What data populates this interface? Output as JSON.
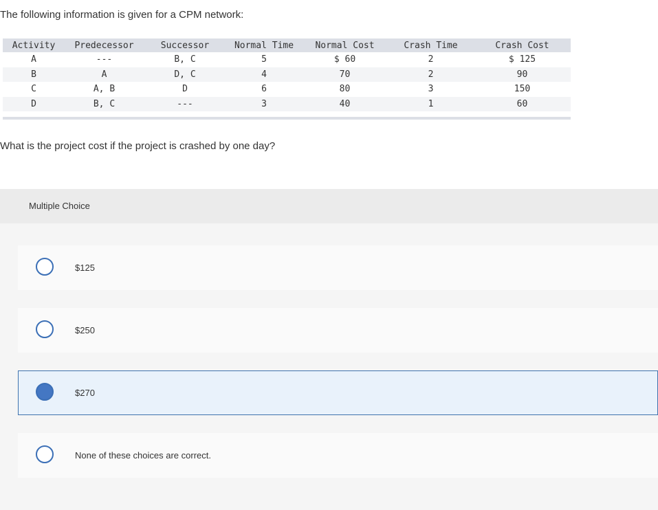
{
  "intro_text": "The following information is given for a CPM network:",
  "table": {
    "headers": {
      "activity": "Activity",
      "predecessor": "Predecessor",
      "successor": "Successor",
      "normal_time": "Normal Time",
      "normal_cost": "Normal Cost",
      "crash_time": "Crash Time",
      "crash_cost": "Crash Cost"
    },
    "rows": [
      {
        "activity": "A",
        "predecessor": "---",
        "successor": "B, C",
        "normal_time": "5",
        "normal_cost": "$ 60",
        "crash_time": "2",
        "crash_cost": "$ 125"
      },
      {
        "activity": "B",
        "predecessor": "A",
        "successor": "D, C",
        "normal_time": "4",
        "normal_cost": "70",
        "crash_time": "2",
        "crash_cost": "90"
      },
      {
        "activity": "C",
        "predecessor": "A, B",
        "successor": "D",
        "normal_time": "6",
        "normal_cost": "80",
        "crash_time": "3",
        "crash_cost": "150"
      },
      {
        "activity": "D",
        "predecessor": "B, C",
        "successor": "---",
        "normal_time": "3",
        "normal_cost": "40",
        "crash_time": "1",
        "crash_cost": "60"
      }
    ]
  },
  "question_text": "What is the project cost if the project is crashed by one day?",
  "multiple_choice": {
    "label": "Multiple Choice",
    "choices": [
      {
        "label": "$125",
        "selected": false
      },
      {
        "label": "$250",
        "selected": false
      },
      {
        "label": "$270",
        "selected": true
      },
      {
        "label": "None of these choices are correct.",
        "selected": false
      }
    ]
  },
  "colors": {
    "accent": "#4477c3",
    "selected_background": "#e9f2fb",
    "table_header_background": "#dcdfe6"
  }
}
